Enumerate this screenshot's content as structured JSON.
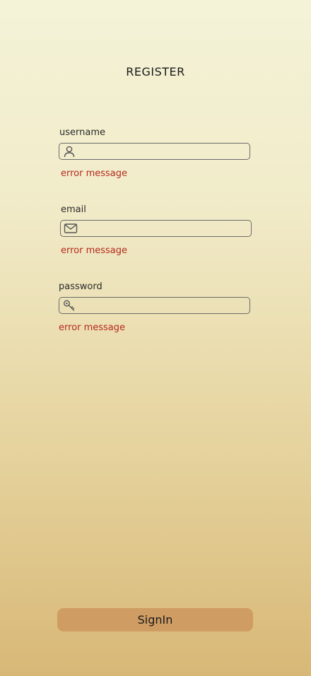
{
  "header": {
    "title": "REGISTER"
  },
  "form": {
    "username": {
      "label": "username",
      "value": "",
      "placeholder": "",
      "icon": "user-icon",
      "error": "error message"
    },
    "email": {
      "label": "email",
      "value": "",
      "placeholder": "",
      "icon": "mail-icon",
      "error": "error message"
    },
    "password": {
      "label": "password",
      "value": "",
      "placeholder": "",
      "icon": "key-icon",
      "error": "error message"
    }
  },
  "actions": {
    "submit_label": "SignIn"
  },
  "colors": {
    "error": "#b52a1e",
    "button": "#cf9c63",
    "background_top": "#f4f3d8",
    "background_bottom": "#d8b877"
  }
}
